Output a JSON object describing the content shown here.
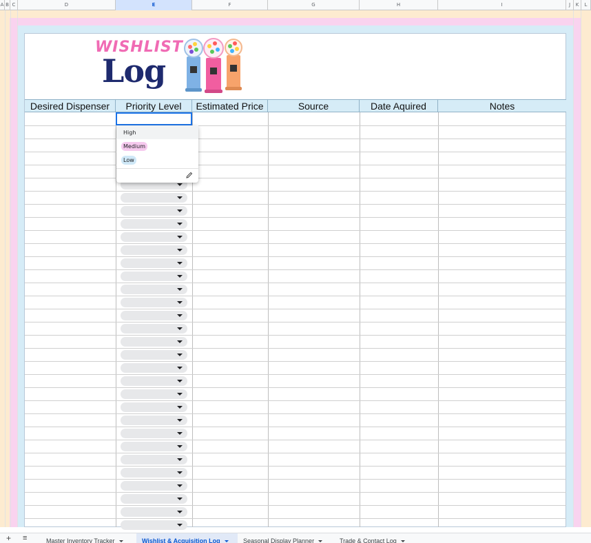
{
  "columns": [
    "A",
    "B",
    "C",
    "D",
    "E",
    "F",
    "G",
    "H",
    "I",
    "J",
    "K",
    "L"
  ],
  "selected_column": "E",
  "logo": {
    "line1": "WISHLIST",
    "line2": "Log"
  },
  "colors": {
    "peach": "#fdebd0",
    "pink": "#f9d3ef",
    "lightblue": "#d6ecf7",
    "header_bg": "#d6ecf7",
    "chip_bg": "#e7e8ea",
    "accent": "#1a73e8"
  },
  "table": {
    "headers": [
      "Desired Dispenser",
      "Priority Level",
      "Estimated Price",
      "Source",
      "Date Aquired",
      "Notes"
    ]
  },
  "dropdown": {
    "options": [
      {
        "label": "High",
        "color": "#fdebd0"
      },
      {
        "label": "Medium",
        "color": "#f6c9ee"
      },
      {
        "label": "Low",
        "color": "#cfe8f7"
      }
    ],
    "edit_icon": "pencil-icon"
  },
  "sheet_tabs": {
    "add_icon": "plus-icon",
    "menu_icon": "list-icon",
    "tabs": [
      {
        "label": "Master Inventory Tracker",
        "active": false
      },
      {
        "label": "Wishlist & Acquisition Log",
        "active": true
      },
      {
        "label": "Seasonal Display Planner",
        "active": false
      },
      {
        "label": "Trade & Contact Log",
        "active": false
      }
    ]
  }
}
